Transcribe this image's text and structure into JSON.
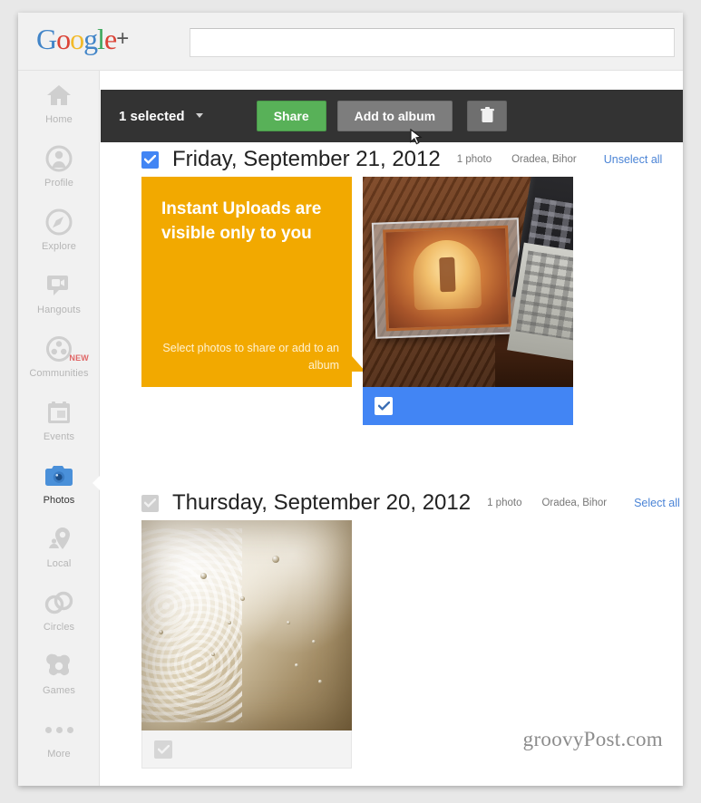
{
  "header": {
    "logo": {
      "letters": [
        "G",
        "o",
        "o",
        "g",
        "l",
        "e"
      ],
      "plus": "+"
    },
    "search": {
      "value": "",
      "placeholder": ""
    }
  },
  "sidebar": {
    "items": [
      {
        "label": "Home",
        "icon": "home-icon",
        "active": false,
        "badge": ""
      },
      {
        "label": "Profile",
        "icon": "profile-icon",
        "active": false,
        "badge": ""
      },
      {
        "label": "Explore",
        "icon": "explore-icon",
        "active": false,
        "badge": ""
      },
      {
        "label": "Hangouts",
        "icon": "hangouts-icon",
        "active": false,
        "badge": ""
      },
      {
        "label": "Communities",
        "icon": "communities-icon",
        "active": false,
        "badge": "NEW"
      },
      {
        "label": "Events",
        "icon": "events-icon",
        "active": false,
        "badge": ""
      },
      {
        "label": "Photos",
        "icon": "camera-icon",
        "active": true,
        "badge": ""
      },
      {
        "label": "Local",
        "icon": "location-pin-icon",
        "active": false,
        "badge": ""
      },
      {
        "label": "Circles",
        "icon": "circles-icon",
        "active": false,
        "badge": ""
      },
      {
        "label": "Games",
        "icon": "games-icon",
        "active": false,
        "badge": ""
      },
      {
        "label": "More",
        "icon": "more-dots-icon",
        "active": false,
        "badge": ""
      }
    ]
  },
  "toolbar": {
    "selected_label": "1 selected",
    "share_label": "Share",
    "add_to_album_label": "Add to album",
    "delete_icon": "trash-icon",
    "colors": {
      "bar": "#333333",
      "share": "#58b158",
      "album": "#7d7d7d"
    }
  },
  "sections": [
    {
      "date": "Friday, September 21, 2012",
      "checked": true,
      "photo_count": "1 photo",
      "location": "Oradea, Bihor",
      "select_link": "Unselect all",
      "instant_uploads": {
        "title": "Instant Uploads are visible only to you",
        "subtitle": "Select photos to share or add to an album",
        "color": "#f2a900"
      },
      "photos": [
        {
          "name": "cd-case-photo",
          "selected": true
        }
      ]
    },
    {
      "date": "Thursday, September 20, 2012",
      "checked": false,
      "photo_count": "1 photo",
      "location": "Oradea, Bihor",
      "select_link": "Select all",
      "instant_uploads": null,
      "photos": [
        {
          "name": "foam-drink-photo",
          "selected": false
        }
      ]
    }
  ],
  "watermark": "groovyPost.com"
}
